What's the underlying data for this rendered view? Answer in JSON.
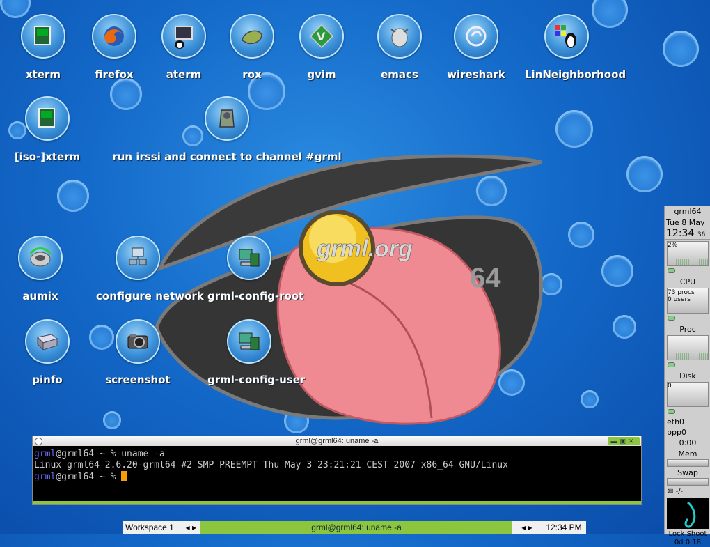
{
  "desktop": {
    "icons": [
      {
        "label": "xterm"
      },
      {
        "label": "firefox"
      },
      {
        "label": "aterm"
      },
      {
        "label": "rox"
      },
      {
        "label": "gvim"
      },
      {
        "label": "emacs"
      },
      {
        "label": "wireshark"
      },
      {
        "label": "LinNeighborhood"
      },
      {
        "label": "[iso-]xterm"
      },
      {
        "label": "run irssi and connect to channel #grml"
      },
      {
        "label": "aumix"
      },
      {
        "label": "configure network"
      },
      {
        "label": "grml-config-root"
      },
      {
        "label": "pinfo"
      },
      {
        "label": "screenshot"
      },
      {
        "label": "grml-config-user"
      }
    ],
    "wallpaper": {
      "logo_text": "grml.org",
      "badge": "64"
    }
  },
  "terminal": {
    "title": "grml@grml64: uname -a",
    "user": "grml",
    "host_prompt": "@grml64 ~ % ",
    "command": "uname -a",
    "output": "Linux grml64 2.6.20-grml64 #2 SMP PREEMPT Thu May 3 23:21:21 CEST 2007 x86_64 GNU/Linux"
  },
  "taskbar": {
    "workspace": "Workspace 1",
    "workspace_arrows": "◂ ▸",
    "task": "grml@grml64: uname -a",
    "task_arrows": "◂ ▸",
    "clock": "12:34 PM"
  },
  "gkrellm": {
    "host": "grml64",
    "date": "Tue  8 May",
    "time": "12:34",
    "seconds": "36",
    "cpu_percent": "2%",
    "cpu_label": "CPU",
    "procs": "73 procs",
    "users": "0 users",
    "proc_label": "Proc",
    "disk_value": "0",
    "disk_label": "Disk",
    "eth_label": "eth0",
    "ppp_label": "ppp0",
    "ppp_time": "0:00",
    "mem_label": "Mem",
    "swap_label": "Swap",
    "mail_count": "-/-",
    "lock_label": "Lock",
    "shoot_label": "Shoot",
    "uptime": "0d  0:18"
  },
  "colors": {
    "accent": "#8cc63f",
    "desktop": "#1368c8",
    "prompt_user": "#6b6bff",
    "cursor": "#f5a000"
  }
}
